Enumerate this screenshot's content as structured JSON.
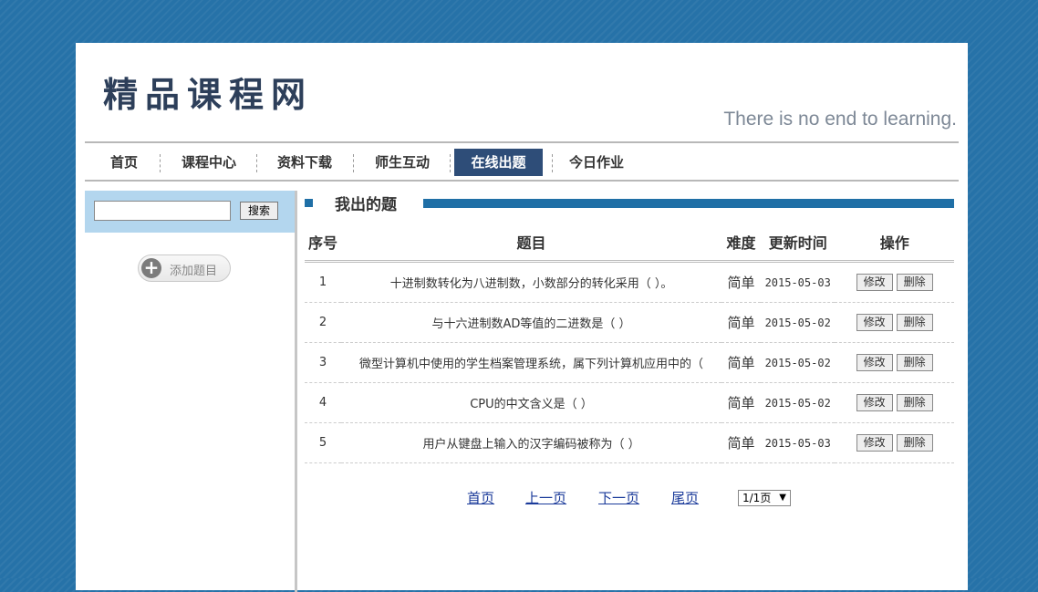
{
  "header": {
    "logo": "精品课程网",
    "slogan": "There is no end to learning."
  },
  "nav": {
    "items": [
      "首页",
      "课程中心",
      "资料下载",
      "师生互动",
      "在线出题",
      "今日作业"
    ],
    "active": "在线出题"
  },
  "sidebar": {
    "search_button": "搜索",
    "search_value": "",
    "add_button": "添加题目"
  },
  "section": {
    "title": "我出的题"
  },
  "table": {
    "headers": [
      "序号",
      "题目",
      "难度",
      "更新时间",
      "操作"
    ],
    "rows": [
      {
        "no": "1",
        "question": "十进制数转化为八进制数，小数部分的转化采用（ ）。",
        "difficulty": "简单",
        "date": "2015-05-03",
        "edit": "修改",
        "delete": "删除"
      },
      {
        "no": "2",
        "question": "与十六进制数AD等值的二进数是（ ）",
        "difficulty": "简单",
        "date": "2015-05-02",
        "edit": "修改",
        "delete": "删除"
      },
      {
        "no": "3",
        "question": "微型计算机中使用的学生档案管理系统，属下列计算机应用中的（",
        "difficulty": "简单",
        "date": "2015-05-02",
        "edit": "修改",
        "delete": "删除"
      },
      {
        "no": "4",
        "question": "CPU的中文含义是（ ）",
        "difficulty": "简单",
        "date": "2015-05-02",
        "edit": "修改",
        "delete": "删除"
      },
      {
        "no": "5",
        "question": "用户从键盘上输入的汉字编码被称为（ ）",
        "difficulty": "简单",
        "date": "2015-05-03",
        "edit": "修改",
        "delete": "删除"
      }
    ]
  },
  "pager": {
    "first": "首页",
    "prev": "上一页",
    "next": "下一页",
    "last": "尾页",
    "select_value": "1/1页"
  },
  "colors": {
    "background": "#2672a8",
    "accent": "#1f6fa6",
    "nav_active": "#2e4d78"
  }
}
